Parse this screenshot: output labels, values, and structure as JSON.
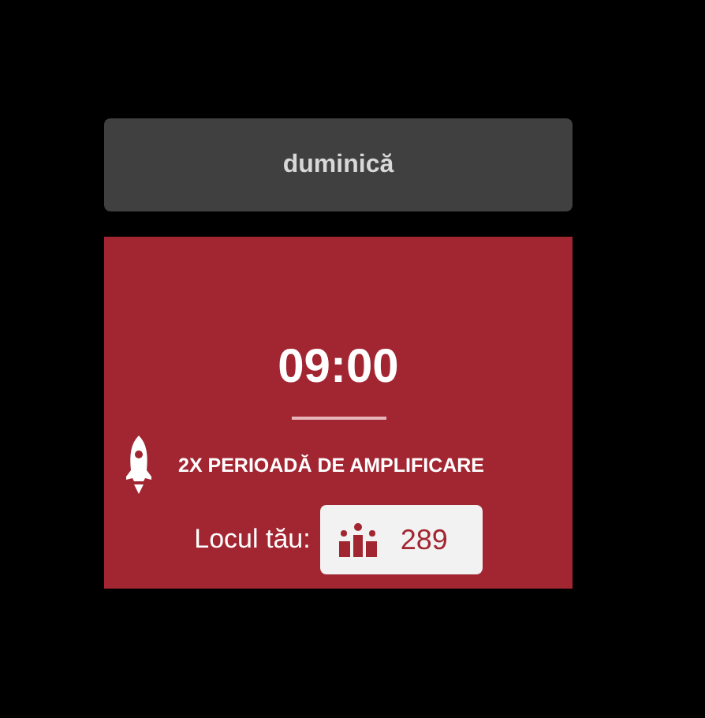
{
  "day": {
    "label": "duminică"
  },
  "slot": {
    "time": "09:00",
    "boost": "2X PERIOADĂ DE AMPLIFICARE",
    "rank_label": "Locul tău:",
    "rank": "289"
  }
}
